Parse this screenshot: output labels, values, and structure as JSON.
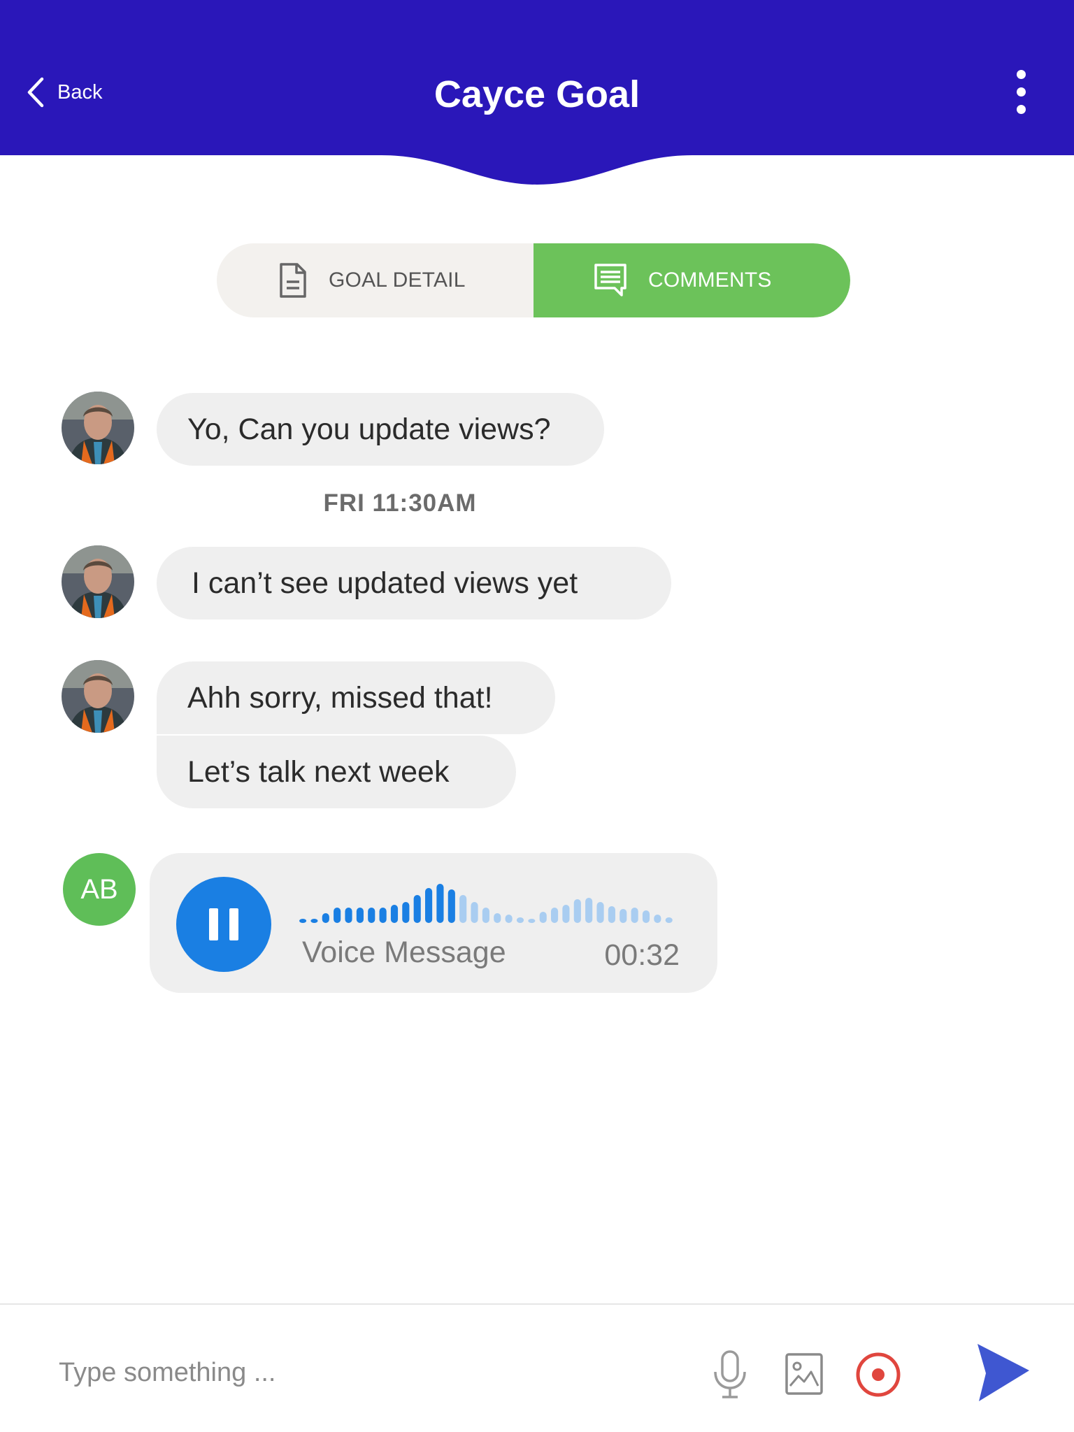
{
  "header": {
    "back_label": "Back",
    "title": "Cayce Goal",
    "bg_color": "#2a17b9"
  },
  "tabs": [
    {
      "label": "GOAL DETAIL",
      "icon": "document-icon",
      "active": false
    },
    {
      "label": "COMMENTS",
      "icon": "comment-icon",
      "active": true
    }
  ],
  "messages": [
    {
      "text": "Yo, Can you update views?"
    },
    {
      "timestamp": "FRI 11:30AM"
    },
    {
      "text": "I can’t see updated views yet"
    },
    {
      "text": "Ahh sorry, missed that!"
    },
    {
      "text": "Let’s talk next week"
    }
  ],
  "voice_message": {
    "avatar_initials": "AB",
    "label": "Voice Message",
    "duration": "00:32",
    "state": "playing",
    "progress": 0.42
  },
  "composer": {
    "placeholder": "Type something ...",
    "icons": [
      "microphone-icon",
      "image-icon",
      "record-icon",
      "send-icon"
    ]
  },
  "colors": {
    "accent_green": "#6cc25a",
    "play_blue": "#1a7fe3",
    "record_red": "#e0463e",
    "send_blue": "#3f57d1"
  }
}
